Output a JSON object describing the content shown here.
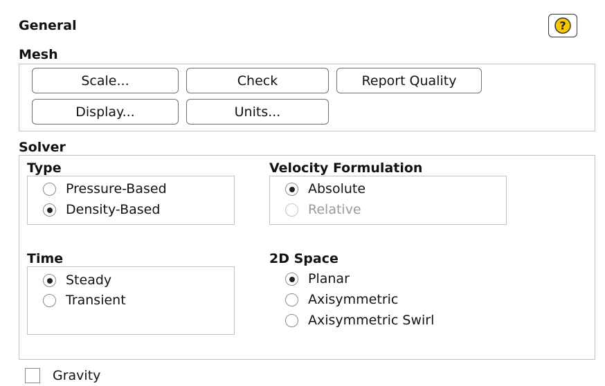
{
  "panel": {
    "title": "General",
    "help_icon": "?"
  },
  "mesh": {
    "title": "Mesh",
    "buttons": {
      "scale": "Scale...",
      "check": "Check",
      "report_quality": "Report Quality",
      "display": "Display...",
      "units": "Units..."
    }
  },
  "solver": {
    "title": "Solver",
    "type": {
      "title": "Type",
      "options": [
        {
          "label": "Pressure-Based",
          "checked": false
        },
        {
          "label": "Density-Based",
          "checked": true
        }
      ]
    },
    "velocity_formulation": {
      "title": "Velocity Formulation",
      "options": [
        {
          "label": "Absolute",
          "checked": true,
          "enabled": true
        },
        {
          "label": "Relative",
          "checked": false,
          "enabled": false
        }
      ]
    },
    "time": {
      "title": "Time",
      "options": [
        {
          "label": "Steady",
          "checked": true
        },
        {
          "label": "Transient",
          "checked": false
        }
      ]
    },
    "space_2d": {
      "title": "2D Space",
      "options": [
        {
          "label": "Planar",
          "checked": true
        },
        {
          "label": "Axisymmetric",
          "checked": false
        },
        {
          "label": "Axisymmetric Swirl",
          "checked": false
        }
      ]
    }
  },
  "gravity": {
    "label": "Gravity",
    "checked": false
  }
}
